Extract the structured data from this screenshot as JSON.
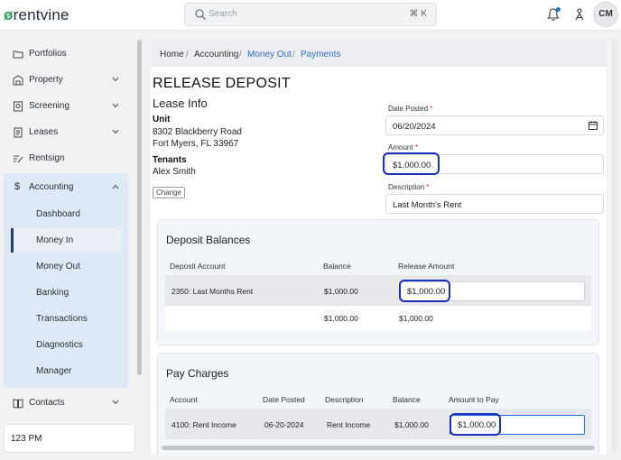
{
  "app": {
    "logo_text": "rentvine"
  },
  "header": {
    "search_placeholder": "Search",
    "search_shortcut": "⌘ K",
    "avatar_initials": "CM"
  },
  "sidebar": {
    "items": [
      {
        "label": "Portfolios",
        "icon": "folder-icon"
      },
      {
        "label": "Property",
        "icon": "building-icon"
      },
      {
        "label": "Screening",
        "icon": "screening-icon"
      },
      {
        "label": "Leases",
        "icon": "document-icon"
      },
      {
        "label": "Rentsign",
        "icon": "signature-icon"
      },
      {
        "label": "Accounting",
        "icon": "dollar-icon"
      },
      {
        "label": "Contacts",
        "icon": "book-icon"
      }
    ],
    "accounting_sub": [
      "Dashboard",
      "Money In",
      "Money Out",
      "Banking",
      "Transactions",
      "Diagnostics",
      "Manager"
    ],
    "active_sub": "Money In",
    "time": "123 PM"
  },
  "breadcrumb": {
    "home": "Home",
    "accounting": "Accounting",
    "money_out": "Money Out",
    "payments": "Payments",
    "sep": "/"
  },
  "page": {
    "title": "RELEASE DEPOSIT",
    "lease_info_title": "Lease Info",
    "unit_label": "Unit",
    "unit_line1": "8302 Blackberry Road",
    "unit_line2": "Fort Myers, FL 33967",
    "tenants_label": "Tenants",
    "tenant_name": "Alex Smith",
    "change_button": "Change",
    "date_posted_label": "Date Posted",
    "date_posted_value": "06/20/2024",
    "amount_label": "Amount",
    "amount_value": "$1,000.00",
    "description_label": "Description",
    "description_value": "Last Month's Rent",
    "required_mark": "*"
  },
  "deposit_balances": {
    "title": "Deposit Balances",
    "columns": [
      "Deposit Account",
      "Balance",
      "Release Amount"
    ],
    "row": {
      "account": "2350: Last Months Rent",
      "balance": "$1,000.00",
      "release_amount": "$1,000.00"
    },
    "totals": {
      "balance": "$1,000.00",
      "release_amount": "$1,000.00"
    }
  },
  "pay_charges": {
    "title": "Pay Charges",
    "columns": [
      "Account",
      "Date Posted",
      "Description",
      "Balance",
      "Amount to Pay"
    ],
    "row": {
      "account": "4100: Rent Income",
      "date_posted": "06-20-2024",
      "description": "Rent Income",
      "balance": "$1,000.00",
      "amount_to_pay": "$1,000.00"
    }
  },
  "colors": {
    "accent": "#2f6dd0",
    "highlight": "#1a2fbd",
    "active_nav": "#1d3f74",
    "logo_leaf": "#2e9e58"
  }
}
